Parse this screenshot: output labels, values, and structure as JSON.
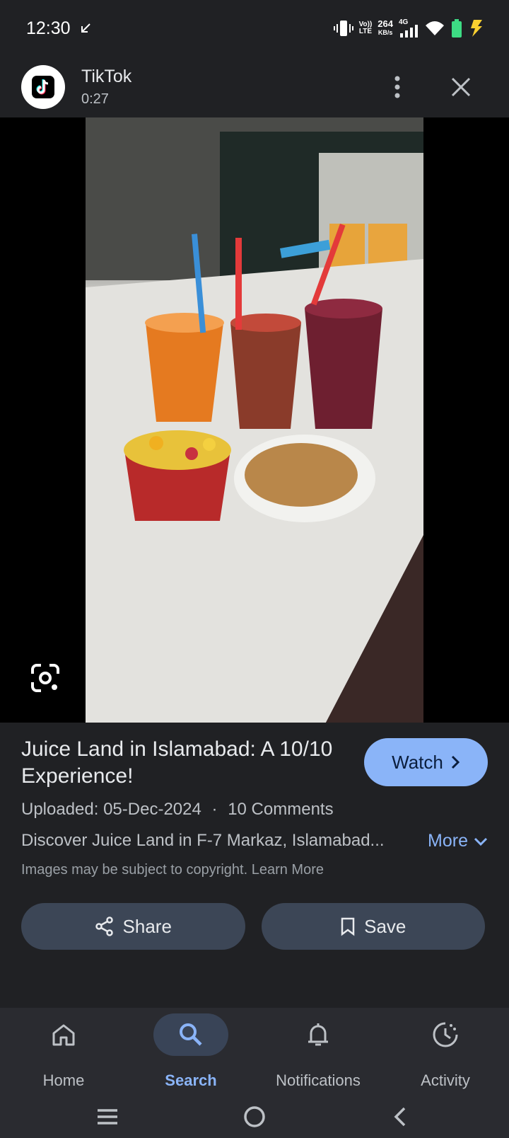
{
  "status_bar": {
    "time": "12:30",
    "network_speed_value": "264",
    "network_speed_unit": "KB/s",
    "volte_top": "Vo))",
    "volte_bottom": "LTE",
    "network_type": "4G"
  },
  "header": {
    "app_name": "TikTok",
    "duration": "0:27"
  },
  "media": {
    "alt": "Juices, fruit chaat and food on a counter"
  },
  "info": {
    "title": "Juice Land in Islamabad: A 10/10 Experience!",
    "watch_label": "Watch",
    "uploaded": "Uploaded: 05-Dec-2024",
    "separator": "·",
    "comments": "10 Comments",
    "description": "Discover Juice Land in F-7 Markaz, Islamabad...",
    "more_label": "More",
    "copyright_text": "Images may be subject to copyright.",
    "learn_more": "Learn More"
  },
  "actions": {
    "share_label": "Share",
    "save_label": "Save"
  },
  "bottom_nav": {
    "items": [
      {
        "label": "Home",
        "icon": "home-icon"
      },
      {
        "label": "Search",
        "icon": "search-icon",
        "active": true
      },
      {
        "label": "Notifications",
        "icon": "bell-icon"
      },
      {
        "label": "Activity",
        "icon": "activity-icon"
      }
    ]
  },
  "colors": {
    "background": "#202124",
    "accent": "#8ab4f8",
    "button_bg": "#3c4656",
    "nav_bg": "#2a2b30"
  }
}
